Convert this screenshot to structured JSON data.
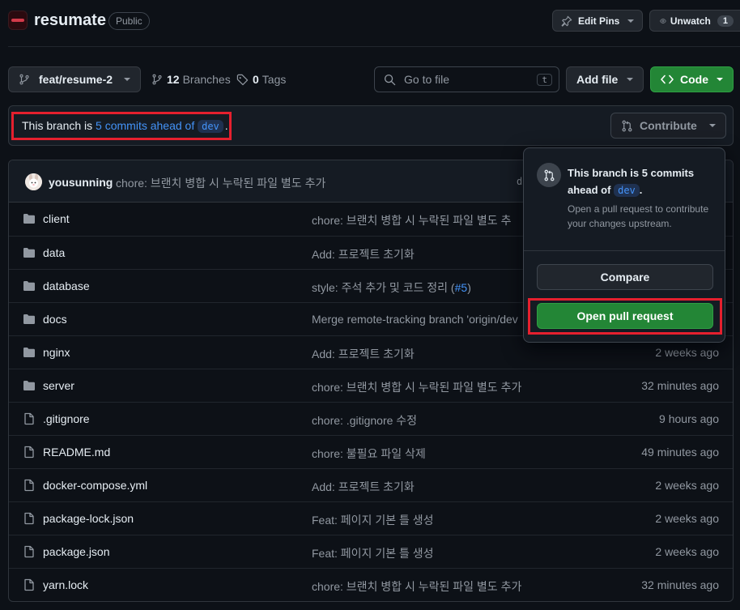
{
  "repo": {
    "name": "resumate",
    "visibility": "Public"
  },
  "header": {
    "edit_pins_label": "Edit Pins",
    "unwatch_label": "Unwatch",
    "watch_count": "1"
  },
  "toolbar": {
    "branch_name": "feat/resume-2",
    "branches_count": "12",
    "branches_label": "Branches",
    "tags_count": "0",
    "tags_label": "Tags",
    "search_placeholder": "Go to file",
    "search_shortcut": "t",
    "add_file_label": "Add file",
    "code_label": "Code"
  },
  "notice": {
    "prefix": "This branch is",
    "link_text": "5 commits ahead of",
    "base_branch": "dev",
    "suffix": ".",
    "contribute_label": "Contribute"
  },
  "latest_commit": {
    "author": "yousunning",
    "message": "chore: 브랜치 병합 시 누락된 파일 별도 추가",
    "hash_partial": "d"
  },
  "files": [
    {
      "type": "dir",
      "name": "client",
      "message": "chore: 브랜치 병합 시 누락된 파일 별도 추",
      "time": ""
    },
    {
      "type": "dir",
      "name": "data",
      "message": "Add: 프로젝트 초기화",
      "time": ""
    },
    {
      "type": "dir",
      "name": "database",
      "message": "style: 주석 추가 및 코드 정리 (",
      "message_link": "#5",
      "message_tail": ")",
      "time": ""
    },
    {
      "type": "dir",
      "name": "docs",
      "message": "Merge remote-tracking branch 'origin/dev",
      "time": ""
    },
    {
      "type": "dir",
      "name": "nginx",
      "message": "Add: 프로젝트 초기화",
      "time": "2 weeks ago"
    },
    {
      "type": "dir",
      "name": "server",
      "message": "chore: 브랜치 병합 시 누락된 파일 별도 추가",
      "time": "32 minutes ago"
    },
    {
      "type": "file",
      "name": ".gitignore",
      "message": "chore: .gitignore 수정",
      "time": "9 hours ago"
    },
    {
      "type": "file",
      "name": "README.md",
      "message": "chore: 불필요 파일 삭제",
      "time": "49 minutes ago"
    },
    {
      "type": "file",
      "name": "docker-compose.yml",
      "message": "Add: 프로젝트 초기화",
      "time": "2 weeks ago"
    },
    {
      "type": "file",
      "name": "package-lock.json",
      "message": "Feat: 페이지 기본 틀 생성",
      "time": "2 weeks ago"
    },
    {
      "type": "file",
      "name": "package.json",
      "message": "Feat: 페이지 기본 틀 생성",
      "time": "2 weeks ago"
    },
    {
      "type": "file",
      "name": "yarn.lock",
      "message": "chore: 브랜치 병합 시 누락된 파일 별도 추가",
      "time": "32 minutes ago"
    }
  ],
  "popover": {
    "title_prefix": "This branch is 5 commits ahead of",
    "base_branch": "dev",
    "title_suffix": ".",
    "description": "Open a pull request to contribute your changes upstream.",
    "compare_label": "Compare",
    "open_pr_label": "Open pull request"
  },
  "colors": {
    "background": "#0d1117",
    "accent_link": "#4493f8",
    "primary_green": "#238636",
    "highlight_red": "#e5202e"
  }
}
